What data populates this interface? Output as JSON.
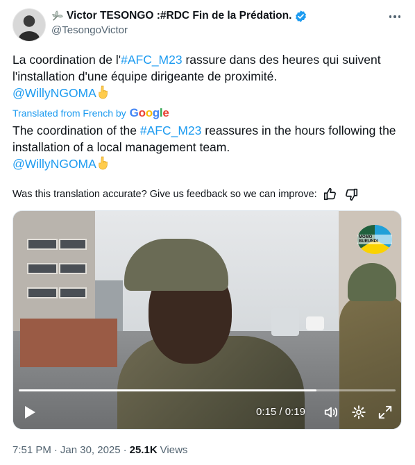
{
  "author": {
    "display_name": "Victor TESONGO :#RDC Fin de la Prédation.",
    "handle": "@TesongoVictor",
    "verified": true
  },
  "tweet": {
    "original_text_before": "La coordination de l'",
    "original_hashtag": "#AFC_M23",
    "original_text_after": " rassure dans des heures qui suivent l'installation d'une équipe dirigeante de proximité.",
    "original_mention": "@WillyNGOMA",
    "translated_from": "Translated from French by",
    "translation_provider": "Google",
    "translated_text_before": "The coordination of the ",
    "translated_hashtag": "#AFC_M23",
    "translated_text_after": " reassures in the hours following the installation of a local management team.",
    "translated_mention": "@WillyNGOMA",
    "feedback_prompt": "Was this translation accurate? Give us feedback so we can improve:"
  },
  "video": {
    "watermark_text": "MOMO BURUNDI",
    "elapsed": "0:15",
    "separator": "/",
    "duration": "0:19",
    "progress": 0.79
  },
  "meta": {
    "time": "7:51 PM",
    "dot": "·",
    "date": "Jan 30, 2025",
    "views_count": "25.1K",
    "views_label": "Views"
  },
  "icons": {
    "more": "more-horizontal-icon",
    "verified": "verified-badge-icon",
    "leaf": "leaf-icon",
    "pointing": "pointing-down-emoji",
    "thumbs_up": "thumbs-up-icon",
    "thumbs_down": "thumbs-down-icon",
    "play": "play-icon",
    "volume": "volume-icon",
    "settings": "settings-gear-icon",
    "fullscreen": "fullscreen-icon"
  },
  "colors": {
    "link": "#1d9bf0",
    "text": "#0f1419",
    "secondary": "#536471"
  }
}
